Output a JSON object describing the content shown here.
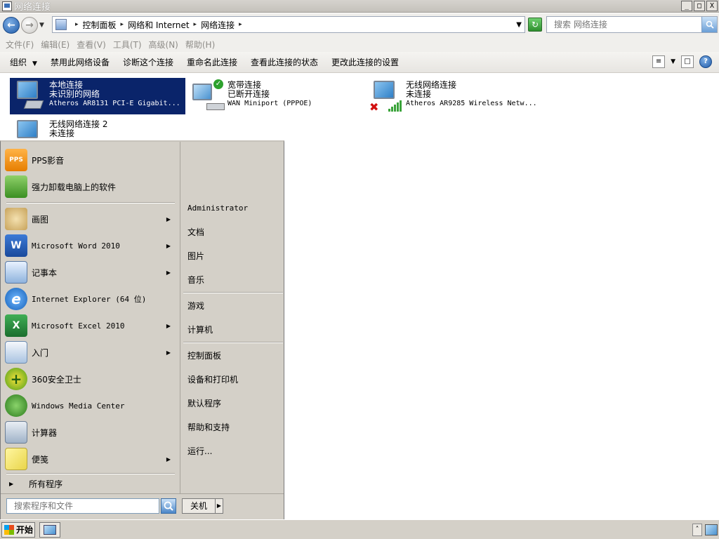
{
  "window": {
    "title": "网络连接",
    "minimize": "_",
    "maximize": "□",
    "close": "X"
  },
  "address": {
    "crumbs": [
      "控制面板",
      "网络和 Internet",
      "网络连接"
    ],
    "search_placeholder": "搜索 网络连接"
  },
  "menubar": [
    "文件(F)",
    "编辑(E)",
    "查看(V)",
    "工具(T)",
    "高级(N)",
    "帮助(H)"
  ],
  "toolbar": {
    "organize": "组织",
    "disable": "禁用此网络设备",
    "diagnose": "诊断这个连接",
    "rename": "重命名此连接",
    "status": "查看此连接的状态",
    "settings": "更改此连接的设置",
    "help": "?"
  },
  "connections": [
    {
      "name": "本地连接",
      "status": "未识别的网络",
      "device": "Atheros AR8131 PCI-E Gigabit..."
    },
    {
      "name": "宽带连接",
      "status": "已断开连接",
      "device": "WAN Miniport (PPPOE)"
    },
    {
      "name": "无线网络连接",
      "status": "未连接",
      "device": "Atheros AR9285 Wireless Netw..."
    },
    {
      "name": "无线网络连接 2",
      "status": "未连接",
      "device": ""
    }
  ],
  "startmenu": {
    "left_items": [
      {
        "label": "PPS影音"
      },
      {
        "label": "强力卸载电脑上的软件"
      },
      {
        "label": "画图"
      },
      {
        "label": "Microsoft Word 2010"
      },
      {
        "label": "记事本"
      },
      {
        "label": "Internet Explorer (64 位)"
      },
      {
        "label": "Microsoft Excel 2010"
      },
      {
        "label": "入门"
      },
      {
        "label": "360安全卫士"
      },
      {
        "label": "Windows Media Center"
      },
      {
        "label": "计算器"
      },
      {
        "label": "便笺"
      }
    ],
    "all_programs": "所有程序",
    "right_items": [
      "Administrator",
      "文档",
      "图片",
      "音乐",
      "游戏",
      "计算机",
      "控制面板",
      "设备和打印机",
      "默认程序",
      "帮助和支持",
      "运行..."
    ],
    "search_placeholder": "搜索程序和文件",
    "shutdown": "关机"
  },
  "taskbar": {
    "start": "开始"
  },
  "icons": {
    "pps": "PPS",
    "word": "W",
    "excel": "X",
    "ie": "e"
  },
  "colors": {
    "selection": "#0a246a",
    "startmenu_bg": "#d4d0c8"
  }
}
